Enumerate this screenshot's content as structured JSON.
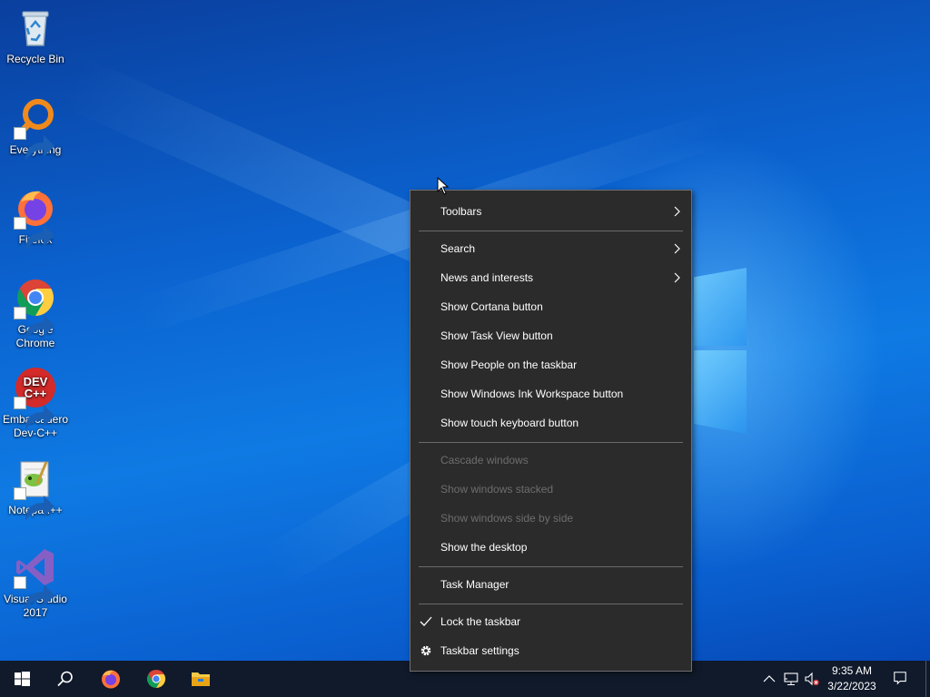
{
  "desktop": {
    "icons": [
      {
        "label": "Recycle Bin",
        "icon": "recycle-bin-icon"
      },
      {
        "label": "Everything",
        "icon": "everything-search-icon"
      },
      {
        "label": "Firefox",
        "icon": "firefox-icon"
      },
      {
        "label": "Google Chrome",
        "icon": "chrome-icon"
      },
      {
        "label": "Embarcadero Dev-C++",
        "icon": "devcpp-icon"
      },
      {
        "label": "Notepad++",
        "icon": "notepadpp-icon"
      },
      {
        "label": "Visual Studio 2017",
        "icon": "visual-studio-icon"
      }
    ],
    "icon_glyph_text": {
      "devcpp": "DEV C++"
    }
  },
  "context_menu": {
    "items": [
      {
        "label": "Toolbars",
        "submenu": true,
        "enabled": true
      },
      {
        "label": "Search",
        "submenu": true,
        "enabled": true
      },
      {
        "label": "News and interests",
        "submenu": true,
        "enabled": true
      },
      {
        "label": "Show Cortana button",
        "enabled": true
      },
      {
        "label": "Show Task View button",
        "enabled": true
      },
      {
        "label": "Show People on the taskbar",
        "enabled": true
      },
      {
        "label": "Show Windows Ink Workspace button",
        "enabled": true
      },
      {
        "label": "Show touch keyboard button",
        "enabled": true
      },
      {
        "label": "Cascade windows",
        "enabled": false
      },
      {
        "label": "Show windows stacked",
        "enabled": false
      },
      {
        "label": "Show windows side by side",
        "enabled": false
      },
      {
        "label": "Show the desktop",
        "enabled": true
      },
      {
        "label": "Task Manager",
        "enabled": true
      },
      {
        "label": "Lock the taskbar",
        "enabled": true,
        "checked": true
      },
      {
        "label": "Taskbar settings",
        "enabled": true,
        "icon": "gear-icon"
      }
    ]
  },
  "taskbar": {
    "pinned": [
      "start-icon",
      "search-icon",
      "firefox-icon",
      "chrome-icon",
      "file-explorer-icon"
    ],
    "tray": [
      "chevron-up-icon",
      "network-icon",
      "volume-muted-icon"
    ],
    "clock": {
      "time": "9:35 AM",
      "date": "3/22/2023"
    }
  },
  "colors": {
    "menu_bg": "#2b2b2b",
    "menu_disabled_text": "#6d6d6d",
    "taskbar_bg": "#101a2b",
    "desktop_blue": "#0b62cf"
  }
}
